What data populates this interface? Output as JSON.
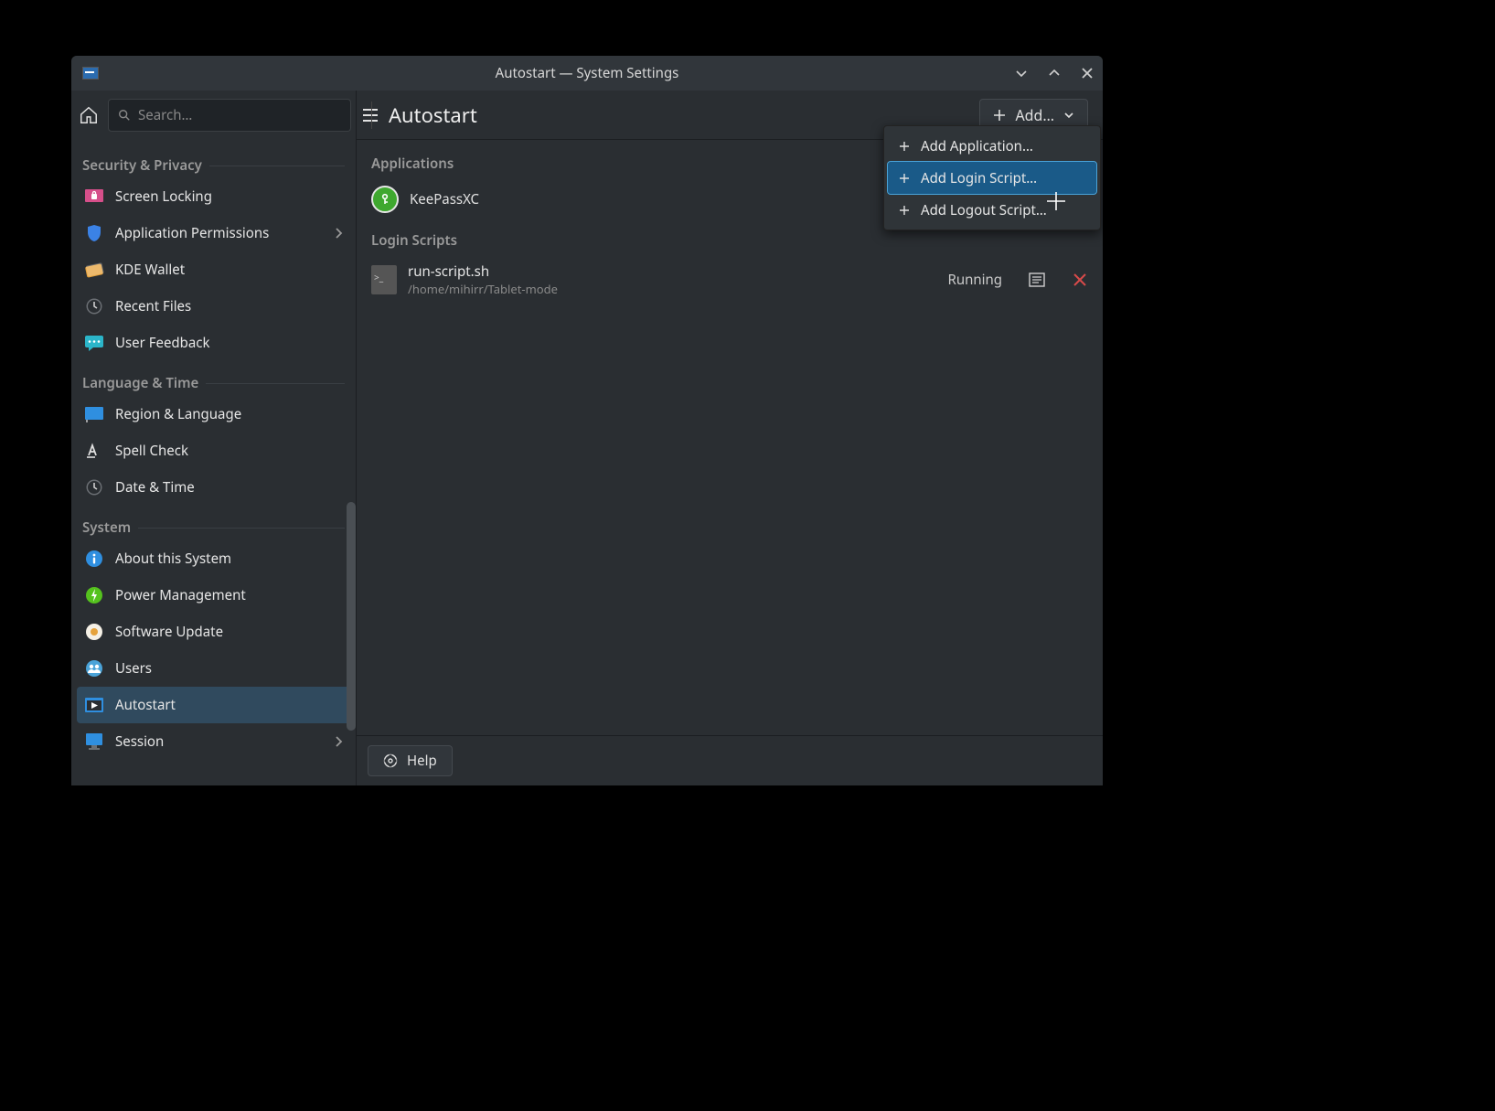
{
  "window": {
    "title": "Autostart — System Settings"
  },
  "toolbar": {
    "search_placeholder": "Search…",
    "page_title": "Autostart",
    "add_label": "Add…",
    "help_label": "Help"
  },
  "dropdown": {
    "items": [
      {
        "label": "Add Application…"
      },
      {
        "label": "Add Login Script…"
      },
      {
        "label": "Add Logout Script…"
      }
    ]
  },
  "sidebar": {
    "groups": [
      {
        "title": "Security & Privacy",
        "items": [
          {
            "label": "Screen Locking",
            "icon": "screen-lock-icon",
            "color": "#d64f8a"
          },
          {
            "label": "Application Permissions",
            "icon": "shield-icon",
            "color": "#3b82e6",
            "chevron": true
          },
          {
            "label": "KDE Wallet",
            "icon": "wallet-icon",
            "color": "#e6a23b"
          },
          {
            "label": "Recent Files",
            "icon": "clock-icon",
            "color": "#6b6f74"
          },
          {
            "label": "User Feedback",
            "icon": "feedback-icon",
            "color": "#2bb5c9"
          }
        ]
      },
      {
        "title": "Language & Time",
        "items": [
          {
            "label": "Region & Language",
            "icon": "flag-icon",
            "color": "#2f8fe0"
          },
          {
            "label": "Spell Check",
            "icon": "spellcheck-icon",
            "color": "#bbbbbb"
          },
          {
            "label": "Date & Time",
            "icon": "clock-icon",
            "color": "#6b6f74"
          }
        ]
      },
      {
        "title": "System",
        "items": [
          {
            "label": "About this System",
            "icon": "info-icon",
            "color": "#2f8fe0"
          },
          {
            "label": "Power Management",
            "icon": "power-icon",
            "color": "#55c21e"
          },
          {
            "label": "Software Update",
            "icon": "update-icon",
            "color": "#e6a23b"
          },
          {
            "label": "Users",
            "icon": "users-icon",
            "color": "#4aa3d8"
          },
          {
            "label": "Autostart",
            "icon": "autostart-icon",
            "color": "#2f8fe0",
            "active": true
          },
          {
            "label": "Session",
            "icon": "session-icon",
            "color": "#2f8fe0",
            "chevron": true
          }
        ]
      }
    ]
  },
  "sections": {
    "applications": {
      "title": "Applications",
      "items": [
        {
          "name": "KeePassXC"
        }
      ]
    },
    "login_scripts": {
      "title": "Login Scripts",
      "items": [
        {
          "name": "run-script.sh",
          "path": "/home/mihirr/Tablet-mode",
          "status": "Running"
        }
      ]
    }
  }
}
